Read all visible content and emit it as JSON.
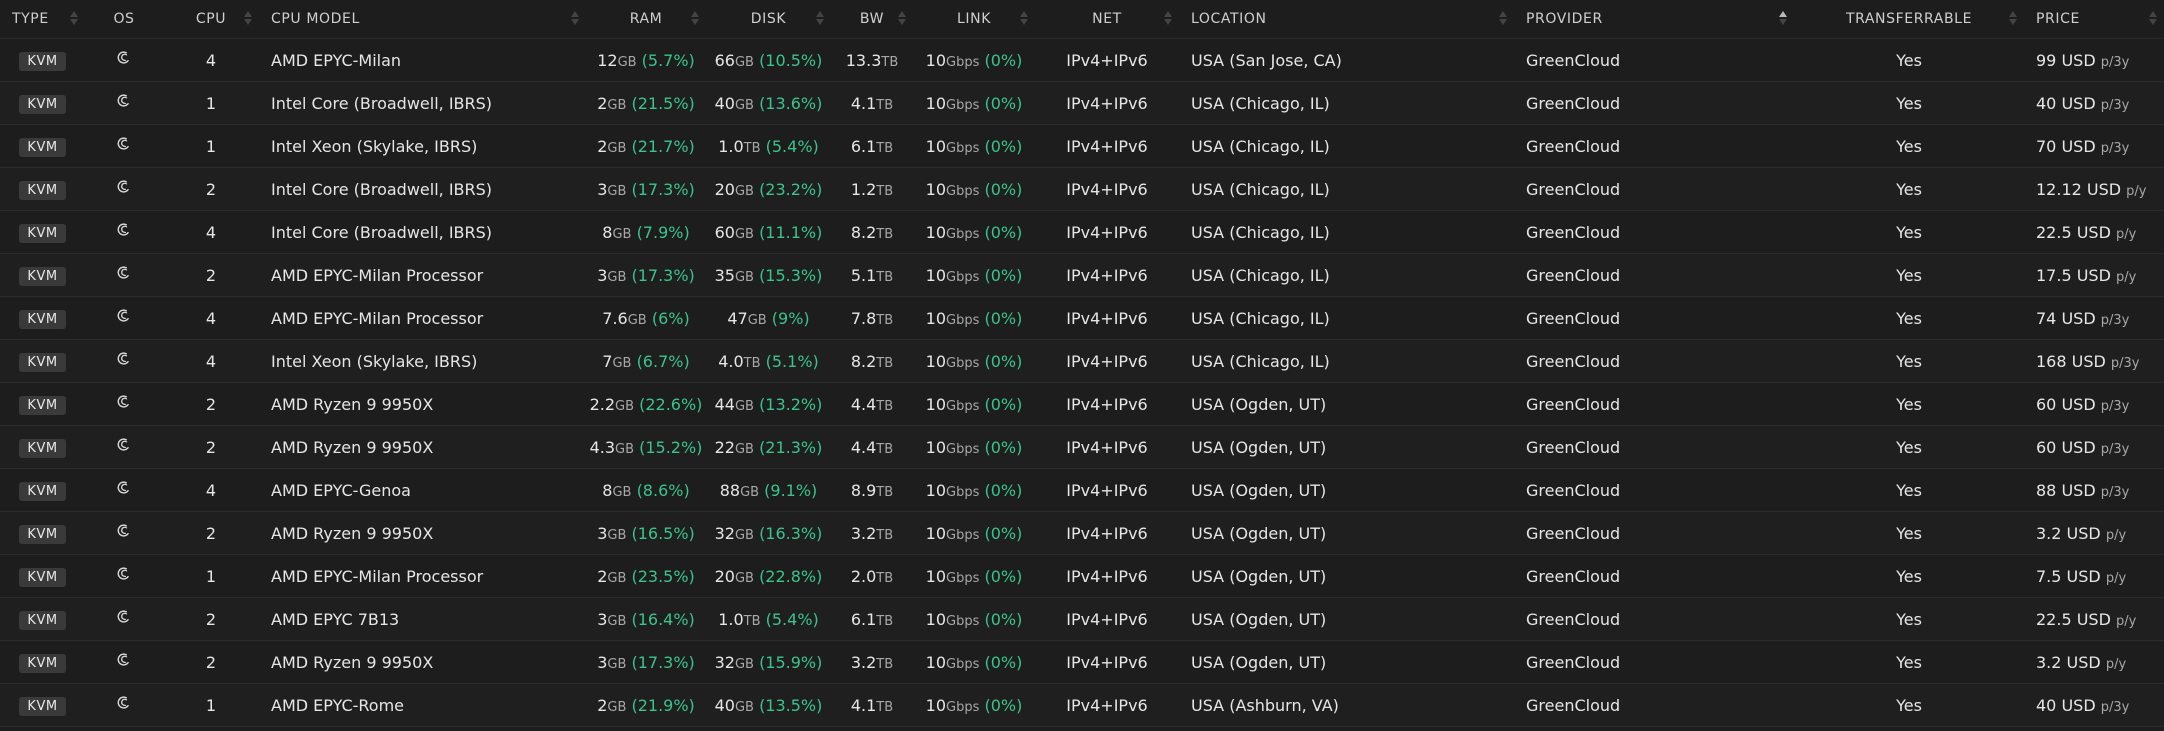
{
  "columns": [
    "TYPE",
    "OS",
    "CPU",
    "CPU MODEL",
    "RAM",
    "DISK",
    "BW",
    "LINK",
    "NET",
    "LOCATION",
    "PROVIDER",
    "TRANSFERRABLE",
    "PRICE"
  ],
  "rows": [
    {
      "type": "KVM",
      "cpu": "4",
      "model": "AMD EPYC-Milan",
      "ram": "12",
      "ram_unit": "GB",
      "ram_pct": "(5.7%)",
      "disk": "66",
      "disk_unit": "GB",
      "disk_pct": "(10.5%)",
      "bw": "13.3",
      "bw_unit": "TB",
      "link": "10",
      "link_unit": "Gbps",
      "link_pct": "(0%)",
      "net": "IPv4+IPv6",
      "location": "USA (San Jose, CA)",
      "provider": "GreenCloud",
      "transfer": "Yes",
      "price": "99 USD",
      "period": "p/3y"
    },
    {
      "type": "KVM",
      "cpu": "1",
      "model": "Intel Core (Broadwell, IBRS)",
      "ram": "2",
      "ram_unit": "GB",
      "ram_pct": "(21.5%)",
      "disk": "40",
      "disk_unit": "GB",
      "disk_pct": "(13.6%)",
      "bw": "4.1",
      "bw_unit": "TB",
      "link": "10",
      "link_unit": "Gbps",
      "link_pct": "(0%)",
      "net": "IPv4+IPv6",
      "location": "USA (Chicago, IL)",
      "provider": "GreenCloud",
      "transfer": "Yes",
      "price": "40 USD",
      "period": "p/3y"
    },
    {
      "type": "KVM",
      "cpu": "1",
      "model": "Intel Xeon (Skylake, IBRS)",
      "ram": "2",
      "ram_unit": "GB",
      "ram_pct": "(21.7%)",
      "disk": "1.0",
      "disk_unit": "TB",
      "disk_pct": "(5.4%)",
      "bw": "6.1",
      "bw_unit": "TB",
      "link": "10",
      "link_unit": "Gbps",
      "link_pct": "(0%)",
      "net": "IPv4+IPv6",
      "location": "USA (Chicago, IL)",
      "provider": "GreenCloud",
      "transfer": "Yes",
      "price": "70 USD",
      "period": "p/3y"
    },
    {
      "type": "KVM",
      "cpu": "2",
      "model": "Intel Core (Broadwell, IBRS)",
      "ram": "3",
      "ram_unit": "GB",
      "ram_pct": "(17.3%)",
      "disk": "20",
      "disk_unit": "GB",
      "disk_pct": "(23.2%)",
      "bw": "1.2",
      "bw_unit": "TB",
      "link": "10",
      "link_unit": "Gbps",
      "link_pct": "(0%)",
      "net": "IPv4+IPv6",
      "location": "USA (Chicago, IL)",
      "provider": "GreenCloud",
      "transfer": "Yes",
      "price": "12.12 USD",
      "period": "p/y"
    },
    {
      "type": "KVM",
      "cpu": "4",
      "model": "Intel Core (Broadwell, IBRS)",
      "ram": "8",
      "ram_unit": "GB",
      "ram_pct": "(7.9%)",
      "disk": "60",
      "disk_unit": "GB",
      "disk_pct": "(11.1%)",
      "bw": "8.2",
      "bw_unit": "TB",
      "link": "10",
      "link_unit": "Gbps",
      "link_pct": "(0%)",
      "net": "IPv4+IPv6",
      "location": "USA (Chicago, IL)",
      "provider": "GreenCloud",
      "transfer": "Yes",
      "price": "22.5 USD",
      "period": "p/y"
    },
    {
      "type": "KVM",
      "cpu": "2",
      "model": "AMD EPYC-Milan Processor",
      "ram": "3",
      "ram_unit": "GB",
      "ram_pct": "(17.3%)",
      "disk": "35",
      "disk_unit": "GB",
      "disk_pct": "(15.3%)",
      "bw": "5.1",
      "bw_unit": "TB",
      "link": "10",
      "link_unit": "Gbps",
      "link_pct": "(0%)",
      "net": "IPv4+IPv6",
      "location": "USA (Chicago, IL)",
      "provider": "GreenCloud",
      "transfer": "Yes",
      "price": "17.5 USD",
      "period": "p/y"
    },
    {
      "type": "KVM",
      "cpu": "4",
      "model": "AMD EPYC-Milan Processor",
      "ram": "7.6",
      "ram_unit": "GB",
      "ram_pct": "(6%)",
      "disk": "47",
      "disk_unit": "GB",
      "disk_pct": "(9%)",
      "bw": "7.8",
      "bw_unit": "TB",
      "link": "10",
      "link_unit": "Gbps",
      "link_pct": "(0%)",
      "net": "IPv4+IPv6",
      "location": "USA (Chicago, IL)",
      "provider": "GreenCloud",
      "transfer": "Yes",
      "price": "74 USD",
      "period": "p/3y"
    },
    {
      "type": "KVM",
      "cpu": "4",
      "model": "Intel Xeon (Skylake, IBRS)",
      "ram": "7",
      "ram_unit": "GB",
      "ram_pct": "(6.7%)",
      "disk": "4.0",
      "disk_unit": "TB",
      "disk_pct": "(5.1%)",
      "bw": "8.2",
      "bw_unit": "TB",
      "link": "10",
      "link_unit": "Gbps",
      "link_pct": "(0%)",
      "net": "IPv4+IPv6",
      "location": "USA (Chicago, IL)",
      "provider": "GreenCloud",
      "transfer": "Yes",
      "price": "168 USD",
      "period": "p/3y"
    },
    {
      "type": "KVM",
      "cpu": "2",
      "model": "AMD Ryzen 9 9950X",
      "ram": "2.2",
      "ram_unit": "GB",
      "ram_pct": "(22.6%)",
      "disk": "44",
      "disk_unit": "GB",
      "disk_pct": "(13.2%)",
      "bw": "4.4",
      "bw_unit": "TB",
      "link": "10",
      "link_unit": "Gbps",
      "link_pct": "(0%)",
      "net": "IPv4+IPv6",
      "location": "USA (Ogden, UT)",
      "provider": "GreenCloud",
      "transfer": "Yes",
      "price": "60 USD",
      "period": "p/3y"
    },
    {
      "type": "KVM",
      "cpu": "2",
      "model": "AMD Ryzen 9 9950X",
      "ram": "4.3",
      "ram_unit": "GB",
      "ram_pct": "(15.2%)",
      "disk": "22",
      "disk_unit": "GB",
      "disk_pct": "(21.3%)",
      "bw": "4.4",
      "bw_unit": "TB",
      "link": "10",
      "link_unit": "Gbps",
      "link_pct": "(0%)",
      "net": "IPv4+IPv6",
      "location": "USA (Ogden, UT)",
      "provider": "GreenCloud",
      "transfer": "Yes",
      "price": "60 USD",
      "period": "p/3y"
    },
    {
      "type": "KVM",
      "cpu": "4",
      "model": "AMD EPYC-Genoa",
      "ram": "8",
      "ram_unit": "GB",
      "ram_pct": "(8.6%)",
      "disk": "88",
      "disk_unit": "GB",
      "disk_pct": "(9.1%)",
      "bw": "8.9",
      "bw_unit": "TB",
      "link": "10",
      "link_unit": "Gbps",
      "link_pct": "(0%)",
      "net": "IPv4+IPv6",
      "location": "USA (Ogden, UT)",
      "provider": "GreenCloud",
      "transfer": "Yes",
      "price": "88 USD",
      "period": "p/3y"
    },
    {
      "type": "KVM",
      "cpu": "2",
      "model": "AMD Ryzen 9 9950X",
      "ram": "3",
      "ram_unit": "GB",
      "ram_pct": "(16.5%)",
      "disk": "32",
      "disk_unit": "GB",
      "disk_pct": "(16.3%)",
      "bw": "3.2",
      "bw_unit": "TB",
      "link": "10",
      "link_unit": "Gbps",
      "link_pct": "(0%)",
      "net": "IPv4+IPv6",
      "location": "USA (Ogden, UT)",
      "provider": "GreenCloud",
      "transfer": "Yes",
      "price": "3.2 USD",
      "period": "p/y"
    },
    {
      "type": "KVM",
      "cpu": "1",
      "model": "AMD EPYC-Milan Processor",
      "ram": "2",
      "ram_unit": "GB",
      "ram_pct": "(23.5%)",
      "disk": "20",
      "disk_unit": "GB",
      "disk_pct": "(22.8%)",
      "bw": "2.0",
      "bw_unit": "TB",
      "link": "10",
      "link_unit": "Gbps",
      "link_pct": "(0%)",
      "net": "IPv4+IPv6",
      "location": "USA (Ogden, UT)",
      "provider": "GreenCloud",
      "transfer": "Yes",
      "price": "7.5 USD",
      "period": "p/y"
    },
    {
      "type": "KVM",
      "cpu": "2",
      "model": "AMD EPYC 7B13",
      "ram": "3",
      "ram_unit": "GB",
      "ram_pct": "(16.4%)",
      "disk": "1.0",
      "disk_unit": "TB",
      "disk_pct": "(5.4%)",
      "bw": "6.1",
      "bw_unit": "TB",
      "link": "10",
      "link_unit": "Gbps",
      "link_pct": "(0%)",
      "net": "IPv4+IPv6",
      "location": "USA (Ogden, UT)",
      "provider": "GreenCloud",
      "transfer": "Yes",
      "price": "22.5 USD",
      "period": "p/y"
    },
    {
      "type": "KVM",
      "cpu": "2",
      "model": "AMD Ryzen 9 9950X",
      "ram": "3",
      "ram_unit": "GB",
      "ram_pct": "(17.3%)",
      "disk": "32",
      "disk_unit": "GB",
      "disk_pct": "(15.9%)",
      "bw": "3.2",
      "bw_unit": "TB",
      "link": "10",
      "link_unit": "Gbps",
      "link_pct": "(0%)",
      "net": "IPv4+IPv6",
      "location": "USA (Ogden, UT)",
      "provider": "GreenCloud",
      "transfer": "Yes",
      "price": "3.2 USD",
      "period": "p/y"
    },
    {
      "type": "KVM",
      "cpu": "1",
      "model": "AMD EPYC-Rome",
      "ram": "2",
      "ram_unit": "GB",
      "ram_pct": "(21.9%)",
      "disk": "40",
      "disk_unit": "GB",
      "disk_pct": "(13.5%)",
      "bw": "4.1",
      "bw_unit": "TB",
      "link": "10",
      "link_unit": "Gbps",
      "link_pct": "(0%)",
      "net": "IPv4+IPv6",
      "location": "USA (Ashburn, VA)",
      "provider": "GreenCloud",
      "transfer": "Yes",
      "price": "40 USD",
      "period": "p/3y"
    }
  ],
  "os_icon": "debian-icon",
  "sorted_column": "PROVIDER",
  "colors": {
    "background": "#1d1d1d",
    "percent": "#39c48d",
    "badge": "#3a3a3a"
  }
}
